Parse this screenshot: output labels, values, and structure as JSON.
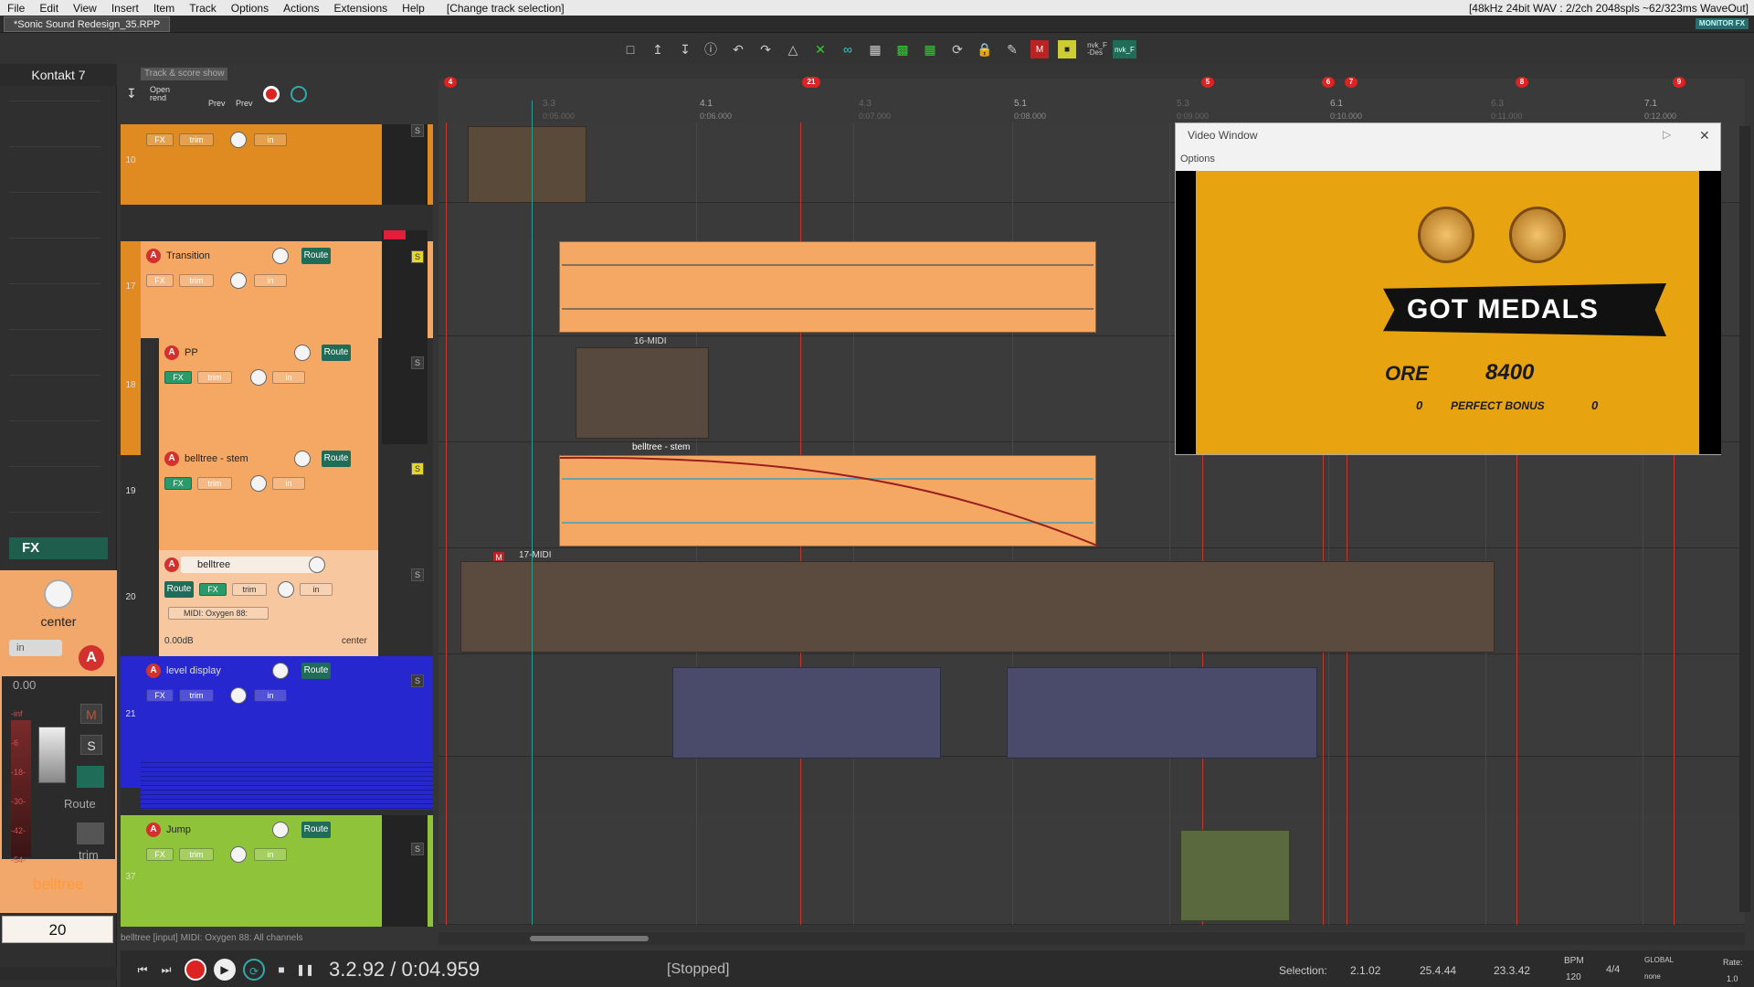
{
  "menu": {
    "items": [
      "File",
      "Edit",
      "View",
      "Insert",
      "Item",
      "Track",
      "Options",
      "Actions",
      "Extensions",
      "Help"
    ],
    "action_hint": "[Change track selection]",
    "status": "[48kHz 24bit WAV : 2/2ch 2048spls ~62/323ms WaveOut]"
  },
  "tabs": {
    "project": "*Sonic Sound Redesign_35.RPP"
  },
  "monitor_fx": "MONITOR FX",
  "toolbar": {
    "nvk_des": "nvk_F\n-Des",
    "nvk_f": "nvk_F"
  },
  "left_panel": {
    "fx_name": "Kontakt 7",
    "fx_label": "FX",
    "pan_label": "center",
    "in_label": "in",
    "arm_label": "A",
    "volume": "0.00",
    "mute": "M",
    "solo": "S",
    "route": "Route",
    "trim": "trim",
    "meter_labels": [
      "-inf",
      "-6",
      "-18-",
      "-30-",
      "-42-",
      "-54-"
    ],
    "track_name": "belltree",
    "track_number": "20"
  },
  "mini_toolbar": {
    "tooltip": "Track & score show",
    "open_label": "Open\nrend",
    "prev1": "Prev",
    "prev2": "Prev"
  },
  "tracks": [
    {
      "num": "10",
      "name": "",
      "color": "#e08a22",
      "folder": false
    },
    {
      "num": "17",
      "name": "Transition",
      "color": "#f4a864",
      "folder": true
    },
    {
      "num": "18",
      "name": "PP",
      "color": "#f4a864",
      "folder": false
    },
    {
      "num": "19",
      "name": "belltree - stem",
      "color": "#f4a864",
      "folder": false
    },
    {
      "num": "20",
      "name": "belltree",
      "color": "#f7c8a0",
      "folder": false,
      "midi_input": "MIDI: Oxygen 88:",
      "volume": "0.00dB",
      "pan": "center"
    },
    {
      "num": "21",
      "name": "level display",
      "color": "#2727cf",
      "folder": true
    },
    {
      "num": "37",
      "name": "Jump",
      "color": "#8fc33a",
      "folder": true
    }
  ],
  "track_controls": {
    "fx": "FX",
    "trim": "trim",
    "in": "in",
    "route": "Route",
    "arm": "A",
    "solo": "S",
    "mute": "M"
  },
  "ruler": {
    "markers": [
      "4",
      "21",
      "5",
      "6",
      "7",
      "8",
      "9"
    ],
    "measures": [
      "4.1",
      "5.1",
      "6.1",
      "7.1"
    ],
    "beats": [
      "3.3",
      "4.3",
      "5.3",
      "6.3"
    ],
    "times": [
      "0:05.000",
      "0:06.000",
      "0:07.000",
      "0:08.000",
      "0:09.000",
      "0:10.000",
      "0:11.000",
      "0:12.000"
    ]
  },
  "items": {
    "midi1": "16-MIDI",
    "belltree_stem": "belltree - stem",
    "midi2": "17-MIDI",
    "midi2_badge": "M"
  },
  "video": {
    "title": "Video Window",
    "options": "Options",
    "headline": "GOT MEDALS",
    "ore": "ORE",
    "score": "8400",
    "zero_left": "0",
    "perfect_bonus": "PERFECT BONUS",
    "zero_right": "0"
  },
  "status_bar": {
    "input_info": "belltree [input] MIDI: Oxygen 88: All channels"
  },
  "transport": {
    "position": "3.2.92 / 0:04.959",
    "state": "[Stopped]",
    "selection_label": "Selection:",
    "selection_start": "2.1.02",
    "selection_end": "25.4.44",
    "selection_length": "23.3.42",
    "bpm_label": "BPM",
    "bpm_value": "120",
    "time_sig": "4/4",
    "global_label": "GLOBAL",
    "global_value": "none",
    "rate_label": "Rate:",
    "rate_value": "1.0"
  }
}
